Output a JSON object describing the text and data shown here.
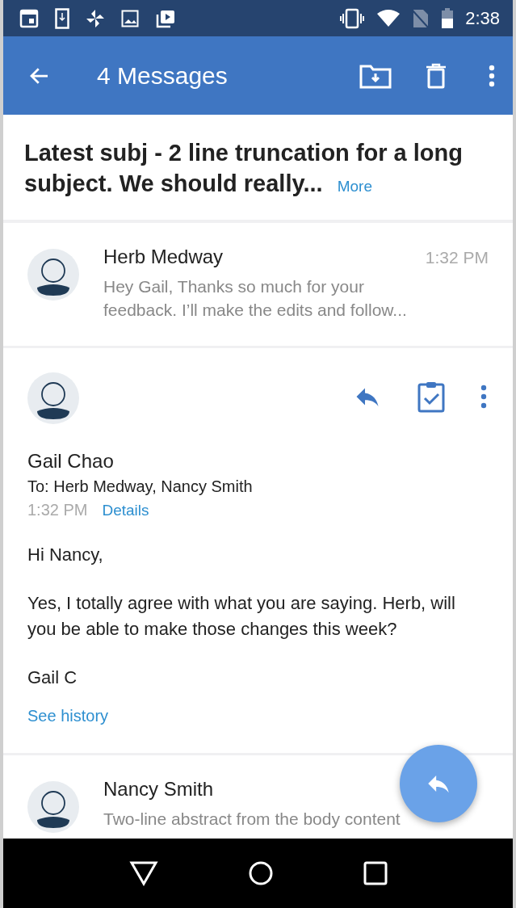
{
  "status_bar": {
    "time": "2:38"
  },
  "app_bar": {
    "title": "4 Messages"
  },
  "thread": {
    "subject": "Latest subj - 2 line truncation for a long subject. We should really...",
    "more_link": "More"
  },
  "messages": [
    {
      "kind": "collapsed",
      "sender": "Herb Medway",
      "time": "1:32 PM",
      "preview": "Hey Gail, Thanks so much for your feedback. I’ll make the edits and follow..."
    },
    {
      "kind": "expanded",
      "sender": "Gail Chao",
      "recipients": "To: Herb Medway, Nancy Smith",
      "time": "1:32 PM",
      "details_link": "Details",
      "body": [
        "Hi Nancy,",
        "Yes, I totally agree with what you are saying. Herb, will you be able to make those changes this week?",
        "Gail C"
      ],
      "history_link": "See history"
    },
    {
      "kind": "collapsed",
      "sender": "Nancy Smith",
      "preview": "Two-line abstract from the body content"
    }
  ]
}
